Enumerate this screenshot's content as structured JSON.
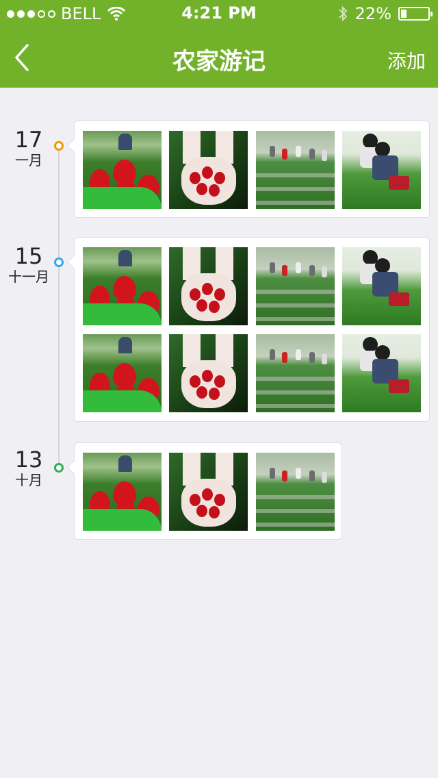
{
  "status_bar": {
    "carrier": "BELL",
    "time": "4:21 PM",
    "battery": "22%",
    "battery_level": 0.22
  },
  "nav": {
    "title": "农家游记",
    "right_action": "添加"
  },
  "entries": [
    {
      "day": "17",
      "month": "一月",
      "node_color": "#f39800",
      "photos": [
        "strawberry-basket",
        "strawberry-hands",
        "strawberry-field",
        "child-picking"
      ]
    },
    {
      "day": "15",
      "month": "十一月",
      "node_color": "#3aa4f0",
      "photos": [
        "strawberry-basket",
        "strawberry-hands",
        "strawberry-field",
        "child-picking",
        "strawberry-basket",
        "strawberry-hands",
        "strawberry-field",
        "child-picking"
      ]
    },
    {
      "day": "13",
      "month": "十月",
      "node_color": "#2fae54",
      "photos": [
        "strawberry-basket",
        "strawberry-hands",
        "strawberry-field"
      ]
    }
  ]
}
